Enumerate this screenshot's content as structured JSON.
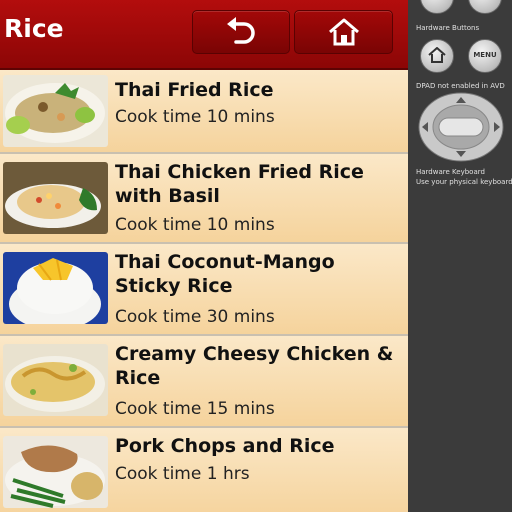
{
  "header": {
    "title": "Rice"
  },
  "recipes": [
    {
      "name": "Thai Fried Rice",
      "cook_time": "Cook time 10 mins"
    },
    {
      "name": "Thai Chicken Fried Rice with Basil",
      "cook_time": "Cook time 10 mins"
    },
    {
      "name": "Thai Coconut-Mango Sticky Rice",
      "cook_time": "Cook time 30 mins"
    },
    {
      "name": "Creamy Cheesy Chicken & Rice",
      "cook_time": "Cook time 15 mins"
    },
    {
      "name": "Pork Chops and Rice",
      "cook_time": "Cook time 1 hrs"
    }
  ],
  "emulator": {
    "hardware_buttons_label": "Hardware Buttons",
    "menu_label": "MENU",
    "dpad_label": "DPAD not enabled in AVD",
    "keyboard_label": "Hardware Keyboard",
    "keyboard_hint": "Use your physical keyboard"
  },
  "colors": {
    "header": "#9e0a0a",
    "row_bg": "#f7dcae",
    "side_panel": "#3b3b3b"
  },
  "icons": {
    "back": "undo-arrow-icon",
    "home": "home-icon"
  }
}
